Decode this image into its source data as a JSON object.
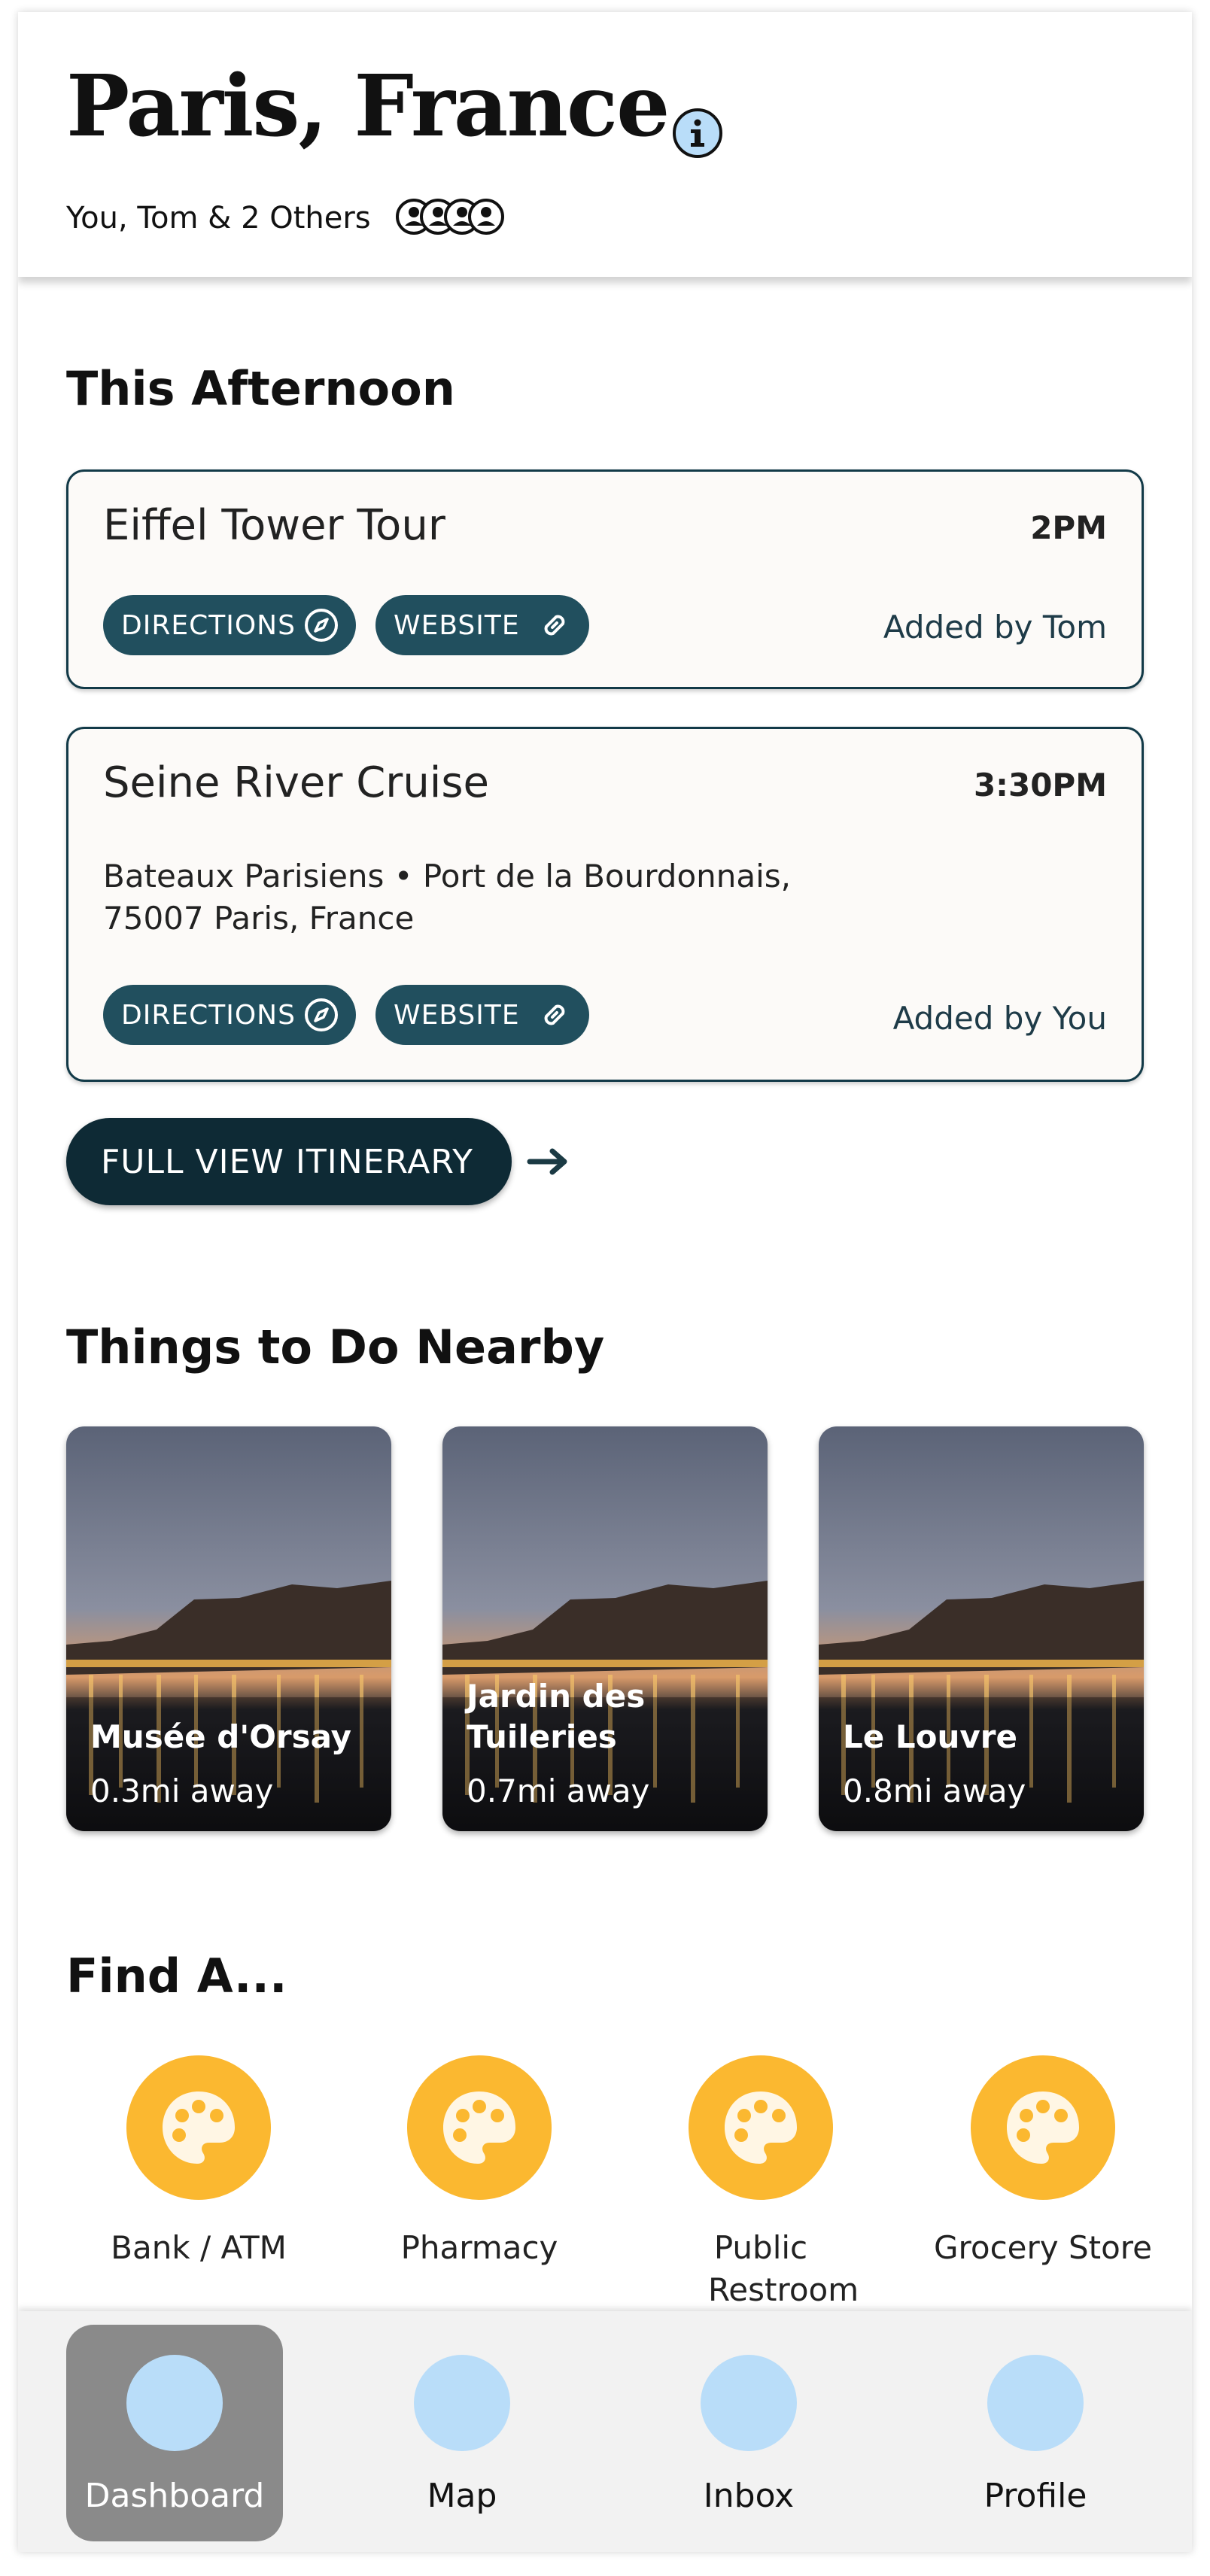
{
  "header": {
    "title": "Paris, France",
    "people_text": "You, Tom & 2 Others",
    "info_icon": "info-icon",
    "people_icon": "group-avatars-icon"
  },
  "afternoon": {
    "heading": "This Afternoon",
    "events": [
      {
        "title": "Eiffel Tower Tour",
        "time": "2PM",
        "address_line1": "",
        "address_line2": "",
        "directions_label": "DIRECTIONS",
        "website_label": "WEBSITE",
        "added_by": "Added by Tom"
      },
      {
        "title": "Seine River Cruise",
        "time": "3:30PM",
        "address_line1": "Bateaux Parisiens • Port de la Bourdonnais,",
        "address_line2": "75007 Paris, France",
        "directions_label": "DIRECTIONS",
        "website_label": "WEBSITE",
        "added_by": "Added by You"
      }
    ],
    "full_view_label": "FULL VIEW ITINERARY"
  },
  "nearby": {
    "heading": "Things to Do Nearby",
    "items": [
      {
        "name": "Musée d'Orsay",
        "distance": "0.3mi away"
      },
      {
        "name": "Jardin des Tuileries",
        "distance": "0.7mi away"
      },
      {
        "name": "Le Louvre",
        "distance": "0.8mi away"
      }
    ]
  },
  "find": {
    "heading": "Find A...",
    "items": [
      {
        "label": "Bank / ATM",
        "icon": "palette-icon"
      },
      {
        "label": "Pharmacy",
        "icon": "palette-icon"
      },
      {
        "label": "Public Restroom",
        "icon": "palette-icon"
      },
      {
        "label": "Grocery Store",
        "icon": "palette-icon"
      }
    ]
  },
  "nav": {
    "items": [
      {
        "label": "Dashboard",
        "active": true
      },
      {
        "label": "Map",
        "active": false
      },
      {
        "label": "Inbox",
        "active": false
      },
      {
        "label": "Profile",
        "active": false
      }
    ]
  },
  "colors": {
    "accent_dark": "#214f5e",
    "button_dark": "#0e2a35",
    "find_circle": "#fbb830",
    "nav_dot": "#b9ddf9",
    "info_icon": "#b9ddf9"
  }
}
